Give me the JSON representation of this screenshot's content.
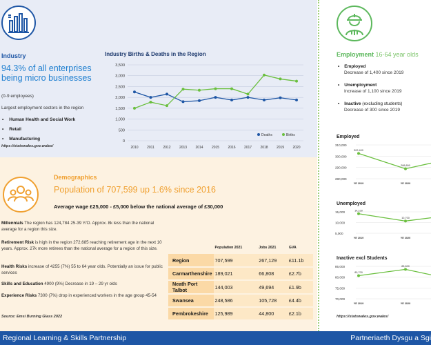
{
  "footer": {
    "left": "Regional Learning & Skills Partnership",
    "right": "Partneriaeth Dysgu a Sgi"
  },
  "industry": {
    "icon": "factory-icon",
    "heading": "Industry",
    "headline": "94.3% of all enterprises being micro businesses",
    "subnote": "(0-9 employees)",
    "sectors_intro": "Largest employment sectors in the region",
    "sectors": [
      "Human Health and Social Work",
      "Retail",
      "Manufacturing"
    ],
    "source": "https://statswales.gov.wales/"
  },
  "chart_data": [
    {
      "type": "line",
      "title": "Industry Births & Deaths in the Region",
      "categories": [
        "2010",
        "2011",
        "2012",
        "2013",
        "2014",
        "2015",
        "2016",
        "2017",
        "2018",
        "2019",
        "2020"
      ],
      "series": [
        {
          "name": "Deaths",
          "color": "#1e56a5",
          "values": [
            2250,
            2000,
            2150,
            1800,
            1850,
            2000,
            1880,
            2000,
            1880,
            1980,
            1880
          ]
        },
        {
          "name": "Births",
          "color": "#6abf3e",
          "values": [
            1500,
            1780,
            1620,
            2380,
            2330,
            2400,
            2400,
            2150,
            3030,
            2850,
            2750
          ]
        }
      ],
      "yticks": [
        "3,500",
        "3,000",
        "2,500",
        "2,000",
        "1,500",
        "1,000",
        "500",
        "0"
      ],
      "ylim": [
        0,
        3500
      ],
      "legend": "bottom-right",
      "grid": true
    },
    {
      "type": "line",
      "title": "Employed",
      "categories": [
        "YE 2019",
        "YE 2020",
        "YE 2021"
      ],
      "series": [
        {
          "name": "",
          "color": "#6abf3e",
          "values": [
            302400,
            288800,
            298000
          ]
        }
      ],
      "data_labels": [
        "302,400",
        "288,800"
      ],
      "yticks": [
        "310,000",
        "300,000",
        "290,000",
        "280,000"
      ],
      "ylim": [
        280000,
        310000
      ]
    },
    {
      "type": "line",
      "title": "Unemployed",
      "categories": [
        "YE 2019",
        "YE 2020",
        "YE 2021"
      ],
      "series": [
        {
          "name": "",
          "color": "#6abf3e",
          "values": [
            14100,
            10700,
            13500
          ]
        }
      ],
      "data_labels": [
        "14,100",
        "10,700"
      ],
      "yticks": [
        "15,000",
        "10,000",
        "5,000"
      ],
      "ylim": [
        5000,
        15000
      ]
    },
    {
      "type": "line",
      "title": "Inactive excl Students",
      "categories": [
        "YE 2019",
        "YE 2020",
        "YE 2021"
      ],
      "series": [
        {
          "name": "",
          "color": "#6abf3e",
          "values": [
            80700,
            83600,
            79000
          ]
        }
      ],
      "data_labels": [
        "80,700",
        "83,600"
      ],
      "yticks": [
        "85,000",
        "80,000",
        "75,000",
        "70,000"
      ],
      "ylim": [
        70000,
        85000
      ]
    }
  ],
  "demographics": {
    "icon": "people-group-icon",
    "heading": "Demographics",
    "headline": "Population of 707,599 up 1.6% since 2016",
    "wage": "Average wage £25,000 - £5,000 below the national average of £30,000",
    "paragraphs": [
      {
        "bold": "Millennials",
        "text": " The region has 124,784 25-39 Y/O. Approx. 8k less than the national average for a region this size."
      },
      {
        "bold": "Retirement Risk",
        "text": " is high in the region 272,685 reaching retirement age in the next 10 years. Approx. 27k more retirees than the national average for a region of this size."
      },
      {
        "bold": "Health Risks",
        "text": " increase of 4255 (7%) 55 to 64 year olds. Potentially an issue for public services"
      },
      {
        "bold": "Skills and Education",
        "text": " 4900 (9%) Decrease in 19 – 29 yr olds"
      },
      {
        "bold": "Experience Risks",
        "text": " 7300 (7%) drop in experienced workers in the age group 45-54"
      }
    ],
    "source": "Source: Emsi Burning Glass 2022",
    "table": {
      "headers": [
        "",
        "Population 2021",
        "Jobs 2021",
        "GVA"
      ],
      "rows": [
        [
          "Region",
          "707,599",
          "267,129",
          "£11.1b"
        ],
        [
          "Carmarthenshire",
          "189,021",
          "66,808",
          "£2.7b"
        ],
        [
          "Neath Port Talbot",
          "144,003",
          "49,694",
          "£1.9b"
        ],
        [
          "Swansea",
          "248,586",
          "105,728",
          "£4.4b"
        ],
        [
          "Pembrokeshire",
          "125,989",
          "44,800",
          "£2.1b"
        ]
      ]
    }
  },
  "employment": {
    "icon": "worker-icon",
    "heading": "Employment",
    "heading_sub": "16-64 year olds",
    "items": [
      {
        "label": "Employed",
        "extra": "",
        "note": "Decrease of 1,400 since 2019"
      },
      {
        "label": "Unemployment",
        "extra": "",
        "note": "Increase of 1,100 since 2019"
      },
      {
        "label": "Inactive",
        "extra": " (excluding students)",
        "note": "Decrease of 300 since 2019"
      }
    ],
    "source": "https://statswales.gov.wales/"
  }
}
